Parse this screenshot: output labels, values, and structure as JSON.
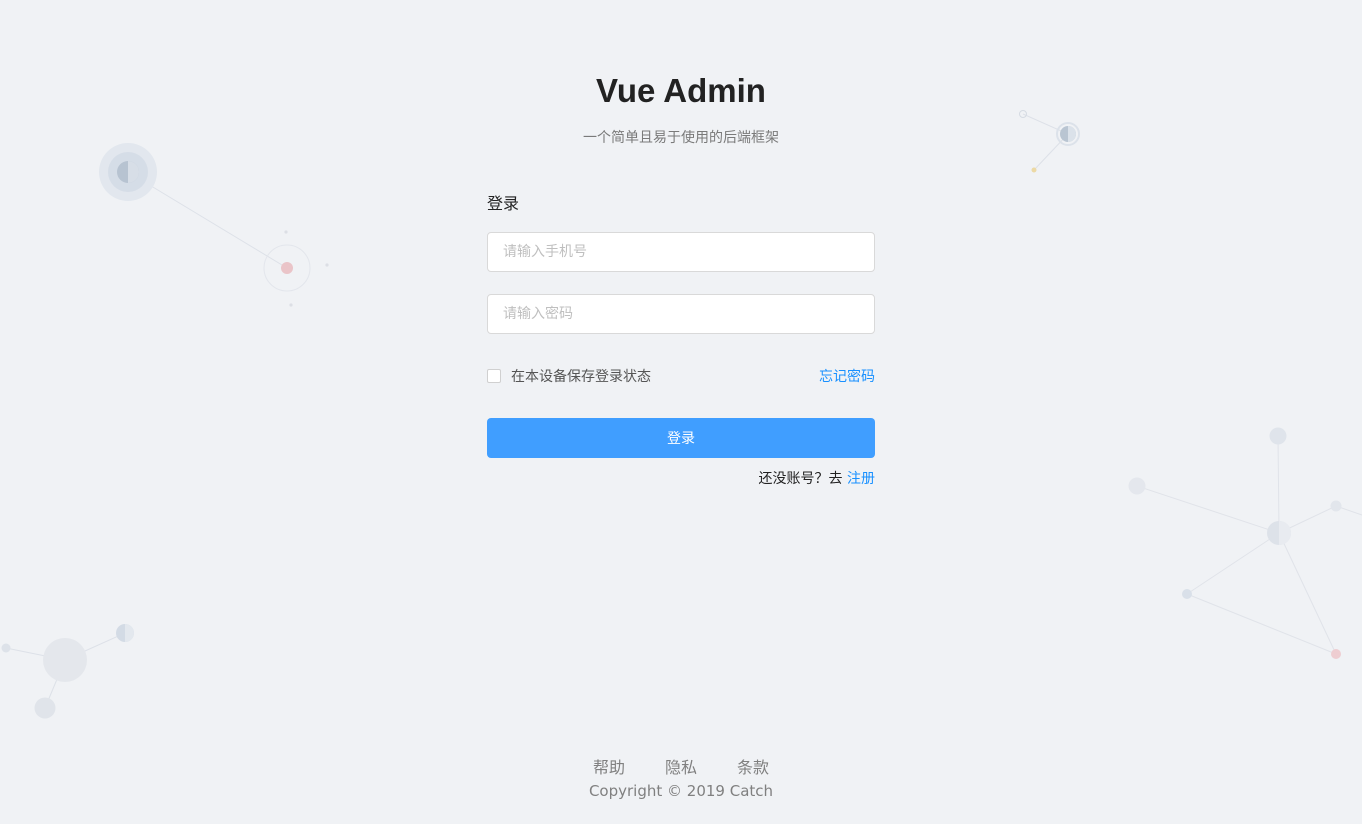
{
  "header": {
    "title": "Vue Admin",
    "subtitle": "一个简单且易于使用的后端框架"
  },
  "login": {
    "heading": "登录",
    "phone_placeholder": "请输入手机号",
    "password_placeholder": "请输入密码",
    "remember_label": "在本设备保存登录状态",
    "remember_checked": false,
    "forgot_label": "忘记密码",
    "submit_label": "登录",
    "register_prompt": "还没账号？去",
    "register_link": "注册"
  },
  "footer": {
    "links": [
      "帮助",
      "隐私",
      "条款"
    ],
    "copyright": "Copyright © 2019 Catch"
  },
  "colors": {
    "background": "#f0f2f5",
    "primary": "#409eff",
    "link": "#1890ff"
  }
}
